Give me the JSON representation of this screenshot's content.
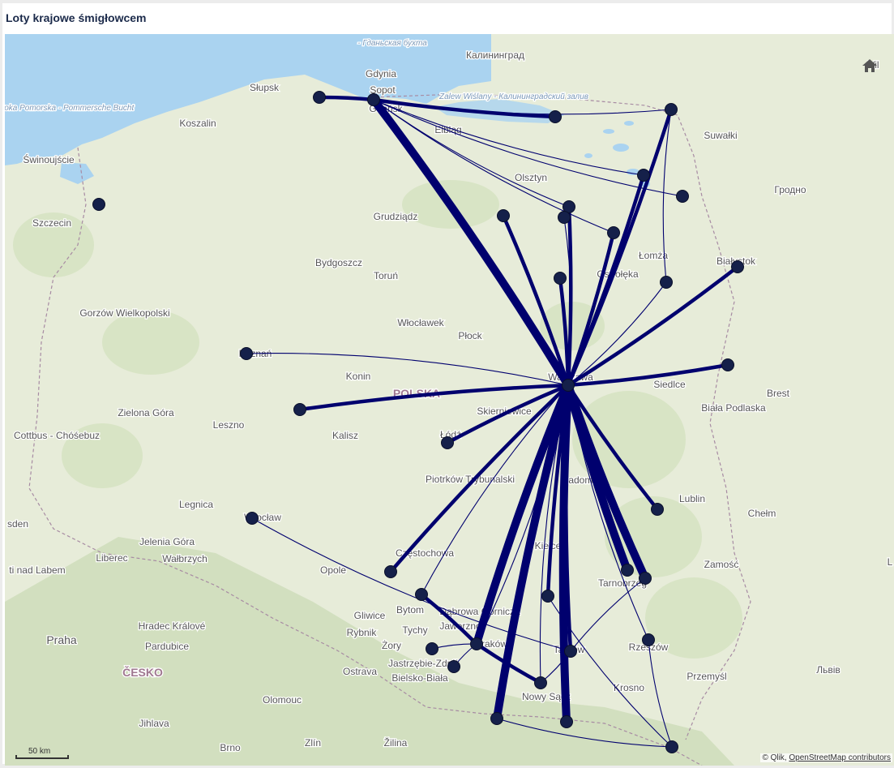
{
  "title": "Loty krajowe śmigłowcem",
  "home_icon": "home-icon",
  "scale_label": "50 km",
  "attribution": {
    "prefix": "© Qlik, ",
    "link": "OpenStreetMap contributors"
  },
  "colors": {
    "route": "#00006e",
    "node": "#15204a",
    "sea": "#aad3f0",
    "land": "#e7ecd9",
    "forest": "#cfdfb8",
    "mountain": "#b9d1a0",
    "label": "#555555",
    "country": "#a07890"
  },
  "places": [
    {
      "name": "- Гданьская бухта"
    },
    {
      "name": "Калининград"
    },
    {
      "name": "Vil"
    },
    {
      "name": "Gdynia"
    },
    {
      "name": "Sopot"
    },
    {
      "name": "Gdańsk"
    },
    {
      "name": "Słupsk"
    },
    {
      "name": "Zatoka Pomorska - Pommersche Bucht"
    },
    {
      "name": "Zalew Wiślany - Калининградский залив"
    },
    {
      "name": "Koszalin"
    },
    {
      "name": "Elbląg"
    },
    {
      "name": "Suwałki"
    },
    {
      "name": "Świnoujście"
    },
    {
      "name": "Olsztyn"
    },
    {
      "name": "Гродно"
    },
    {
      "name": "Szczecin"
    },
    {
      "name": "Grudziądz"
    },
    {
      "name": "Białystok"
    },
    {
      "name": "Łomża"
    },
    {
      "name": "Bydgoszcz"
    },
    {
      "name": "Ostrołęka"
    },
    {
      "name": "Toruń"
    },
    {
      "name": "Gorzów Wielkopolski"
    },
    {
      "name": "Włocławek"
    },
    {
      "name": "Płock"
    },
    {
      "name": "Poznań"
    },
    {
      "name": "Konin"
    },
    {
      "name": "Warszawa"
    },
    {
      "name": "Siedlce"
    },
    {
      "name": "Brest"
    },
    {
      "name": "POLSKA"
    },
    {
      "name": "Biała Podlaska"
    },
    {
      "name": "Skierniewice"
    },
    {
      "name": "Zielona Góra"
    },
    {
      "name": "Leszno"
    },
    {
      "name": "Łódź"
    },
    {
      "name": "Cottbus - Chóśebuz"
    },
    {
      "name": "Kalisz"
    },
    {
      "name": "Piotrków Trybunalski"
    },
    {
      "name": "Radom"
    },
    {
      "name": "Lublin"
    },
    {
      "name": "Legnica"
    },
    {
      "name": "Chełm"
    },
    {
      "name": "Wrocław"
    },
    {
      "name": "sden"
    },
    {
      "name": "Jelenia Góra"
    },
    {
      "name": "Kielce"
    },
    {
      "name": "Częstochowa"
    },
    {
      "name": "Zamość"
    },
    {
      "name": "Liberec"
    },
    {
      "name": "Wałbrzych"
    },
    {
      "name": "Opole"
    },
    {
      "name": "Tarnobrzeg"
    },
    {
      "name": "ti nad Labem"
    },
    {
      "name": "Bytom"
    },
    {
      "name": "Dąbrowa Górnicza"
    },
    {
      "name": "Gliwice"
    },
    {
      "name": "Hradec Králové"
    },
    {
      "name": "Jaworzno"
    },
    {
      "name": "Rybnik"
    },
    {
      "name": "Tychy"
    },
    {
      "name": "Kraków"
    },
    {
      "name": "Praha"
    },
    {
      "name": "Pardubice"
    },
    {
      "name": "Żory"
    },
    {
      "name": "Rzeszów"
    },
    {
      "name": "Tarnów"
    },
    {
      "name": "Jastrzębie-Zdrój"
    },
    {
      "name": "Львів"
    },
    {
      "name": "ČESKO"
    },
    {
      "name": "Ostrava"
    },
    {
      "name": "Przemyśl"
    },
    {
      "name": "Bielsko-Biała"
    },
    {
      "name": "Krosno"
    },
    {
      "name": "Nowy Sącz"
    },
    {
      "name": "Olomouc"
    },
    {
      "name": "Jihlava"
    },
    {
      "name": "Brno"
    },
    {
      "name": "Zlín"
    },
    {
      "name": "Žilina"
    },
    {
      "name": "L"
    }
  ],
  "nodes": [
    {
      "id": "warszawa"
    },
    {
      "id": "gdansk"
    },
    {
      "id": "slupsk"
    },
    {
      "id": "kaliningrad-lagoon"
    },
    {
      "id": "szczecin"
    },
    {
      "id": "suwalki-n"
    },
    {
      "id": "elk"
    },
    {
      "id": "augustow"
    },
    {
      "id": "olsztyn-a"
    },
    {
      "id": "olsztyn-b"
    },
    {
      "id": "ostroda"
    },
    {
      "id": "pisz"
    },
    {
      "id": "lomza"
    },
    {
      "id": "bialystok"
    },
    {
      "id": "ostroleka-w"
    },
    {
      "id": "poznan"
    },
    {
      "id": "konin-w"
    },
    {
      "id": "siedlce-e"
    },
    {
      "id": "lodz"
    },
    {
      "id": "lublin"
    },
    {
      "id": "wroclaw"
    },
    {
      "id": "czestochowa"
    },
    {
      "id": "bytom"
    },
    {
      "id": "krakow"
    },
    {
      "id": "zory"
    },
    {
      "id": "bielsko"
    },
    {
      "id": "kielce-s"
    },
    {
      "id": "tarnobrzeg-a"
    },
    {
      "id": "tarnobrzeg-b"
    },
    {
      "id": "tarnow"
    },
    {
      "id": "rzeszow"
    },
    {
      "id": "nowy-sacz"
    },
    {
      "id": "zakopane"
    },
    {
      "id": "krynica"
    },
    {
      "id": "bieszczady"
    }
  ],
  "routes": [
    {
      "from": "warszawa",
      "to": "gdansk",
      "weight": "heavy"
    },
    {
      "from": "warszawa",
      "to": "krakow",
      "weight": "heavy"
    },
    {
      "from": "warszawa",
      "to": "zakopane",
      "weight": "heavy"
    },
    {
      "from": "warszawa",
      "to": "krynica",
      "weight": "heavy"
    },
    {
      "from": "warszawa",
      "to": "tarnobrzeg-b",
      "weight": "heavy"
    },
    {
      "from": "warszawa",
      "to": "tarnobrzeg-a",
      "weight": "heavy"
    },
    {
      "from": "warszawa",
      "to": "tarnow",
      "weight": "medium"
    },
    {
      "from": "warszawa",
      "to": "kielce-s",
      "weight": "medium"
    },
    {
      "from": "warszawa",
      "to": "pisz",
      "weight": "medium"
    },
    {
      "from": "warszawa",
      "to": "elk",
      "weight": "medium"
    },
    {
      "from": "warszawa",
      "to": "olsztyn-a",
      "weight": "medium"
    },
    {
      "from": "warszawa",
      "to": "ostroda",
      "weight": "medium"
    },
    {
      "from": "warszawa",
      "to": "ostroleka-w",
      "weight": "medium"
    },
    {
      "from": "warszawa",
      "to": "bialystok",
      "weight": "medium"
    },
    {
      "from": "warszawa",
      "to": "siedlce-e",
      "weight": "medium"
    },
    {
      "from": "warszawa",
      "to": "konin-w",
      "weight": "medium"
    },
    {
      "from": "warszawa",
      "to": "lodz",
      "weight": "medium"
    },
    {
      "from": "warszawa",
      "to": "czestochowa",
      "weight": "medium"
    },
    {
      "from": "warszawa",
      "to": "lublin",
      "weight": "medium"
    },
    {
      "from": "warszawa",
      "to": "suwalki-n",
      "weight": "medium"
    },
    {
      "from": "gdansk",
      "to": "slupsk",
      "weight": "medium"
    },
    {
      "from": "gdansk",
      "to": "kaliningrad-lagoon",
      "weight": "medium"
    },
    {
      "from": "krakow",
      "to": "nowy-sacz",
      "weight": "medium"
    },
    {
      "from": "krakow",
      "to": "bytom",
      "weight": "medium"
    },
    {
      "from": "krakow",
      "to": "zory",
      "weight": "thin"
    },
    {
      "from": "krakow",
      "to": "bielsko",
      "weight": "thin"
    },
    {
      "from": "krakow",
      "to": "warszawa",
      "weight": "thin"
    },
    {
      "from": "warszawa",
      "to": "poznan",
      "weight": "thin"
    },
    {
      "from": "warszawa",
      "to": "olsztyn-b",
      "weight": "thin"
    },
    {
      "from": "warszawa",
      "to": "lomza",
      "weight": "thin"
    },
    {
      "from": "warszawa",
      "to": "rzeszow",
      "weight": "thin"
    },
    {
      "from": "warszawa",
      "to": "bytom",
      "weight": "thin"
    },
    {
      "from": "warszawa",
      "to": "nowy-sacz",
      "weight": "thin"
    },
    {
      "from": "gdansk",
      "to": "suwalki-n",
      "weight": "thin"
    },
    {
      "from": "gdansk",
      "to": "augustow",
      "weight": "thin"
    },
    {
      "from": "gdansk",
      "to": "pisz",
      "weight": "thin"
    },
    {
      "from": "gdansk",
      "to": "olsztyn-a",
      "weight": "thin"
    },
    {
      "from": "gdansk",
      "to": "elk",
      "weight": "thin"
    },
    {
      "from": "suwalki-n",
      "to": "lomza",
      "weight": "thin"
    },
    {
      "from": "wroclaw",
      "to": "tarnow",
      "weight": "thin"
    },
    {
      "from": "kielce-s",
      "to": "bieszczady",
      "weight": "thin"
    },
    {
      "from": "tarnobrzeg-b",
      "to": "tarnow",
      "weight": "thin"
    },
    {
      "from": "rzeszow",
      "to": "bieszczady",
      "weight": "thin"
    },
    {
      "from": "zakopane",
      "to": "bieszczady",
      "weight": "thin"
    },
    {
      "from": "nowy-sacz",
      "to": "tarnow",
      "weight": "thin"
    }
  ]
}
